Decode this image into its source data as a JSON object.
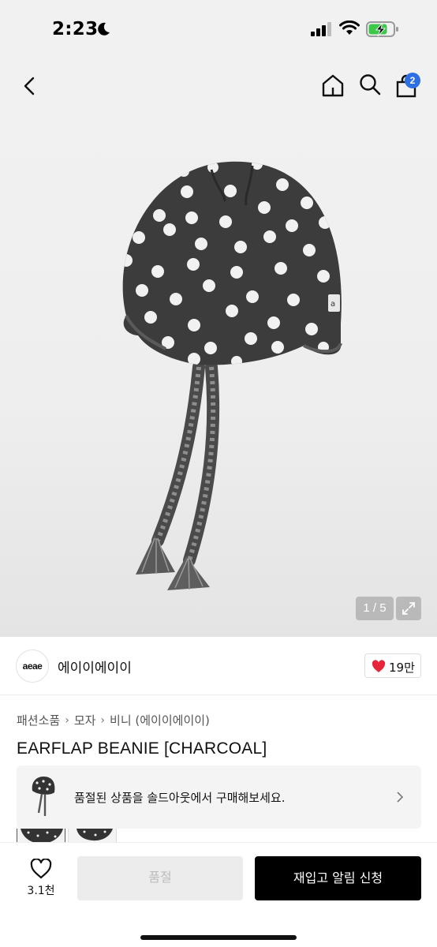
{
  "status_bar": {
    "time": "2:23"
  },
  "header": {
    "cart_count": "2"
  },
  "gallery": {
    "counter": "1 / 5",
    "hat_tag": "a"
  },
  "brand": {
    "logo_text": "aeae",
    "name": "에이이에이이",
    "likes": "19만"
  },
  "breadcrumb": {
    "items": [
      "패션소품",
      "모자",
      "비니 (에이이에이이)"
    ]
  },
  "product": {
    "title": "EARFLAP BEANIE [CHARCOAL]"
  },
  "soldout_banner": {
    "text": "품절된 상품을 솔드아웃에서 구매해보세요."
  },
  "bottom_bar": {
    "wish_count": "3.1천",
    "soldout_label": "품절",
    "restock_label": "재입고 알림 신청"
  },
  "colors": {
    "accent_badge": "#2f6fe4",
    "heart": "#e8243a",
    "hat": "#3c3c3c",
    "primary_button": "#000000"
  }
}
